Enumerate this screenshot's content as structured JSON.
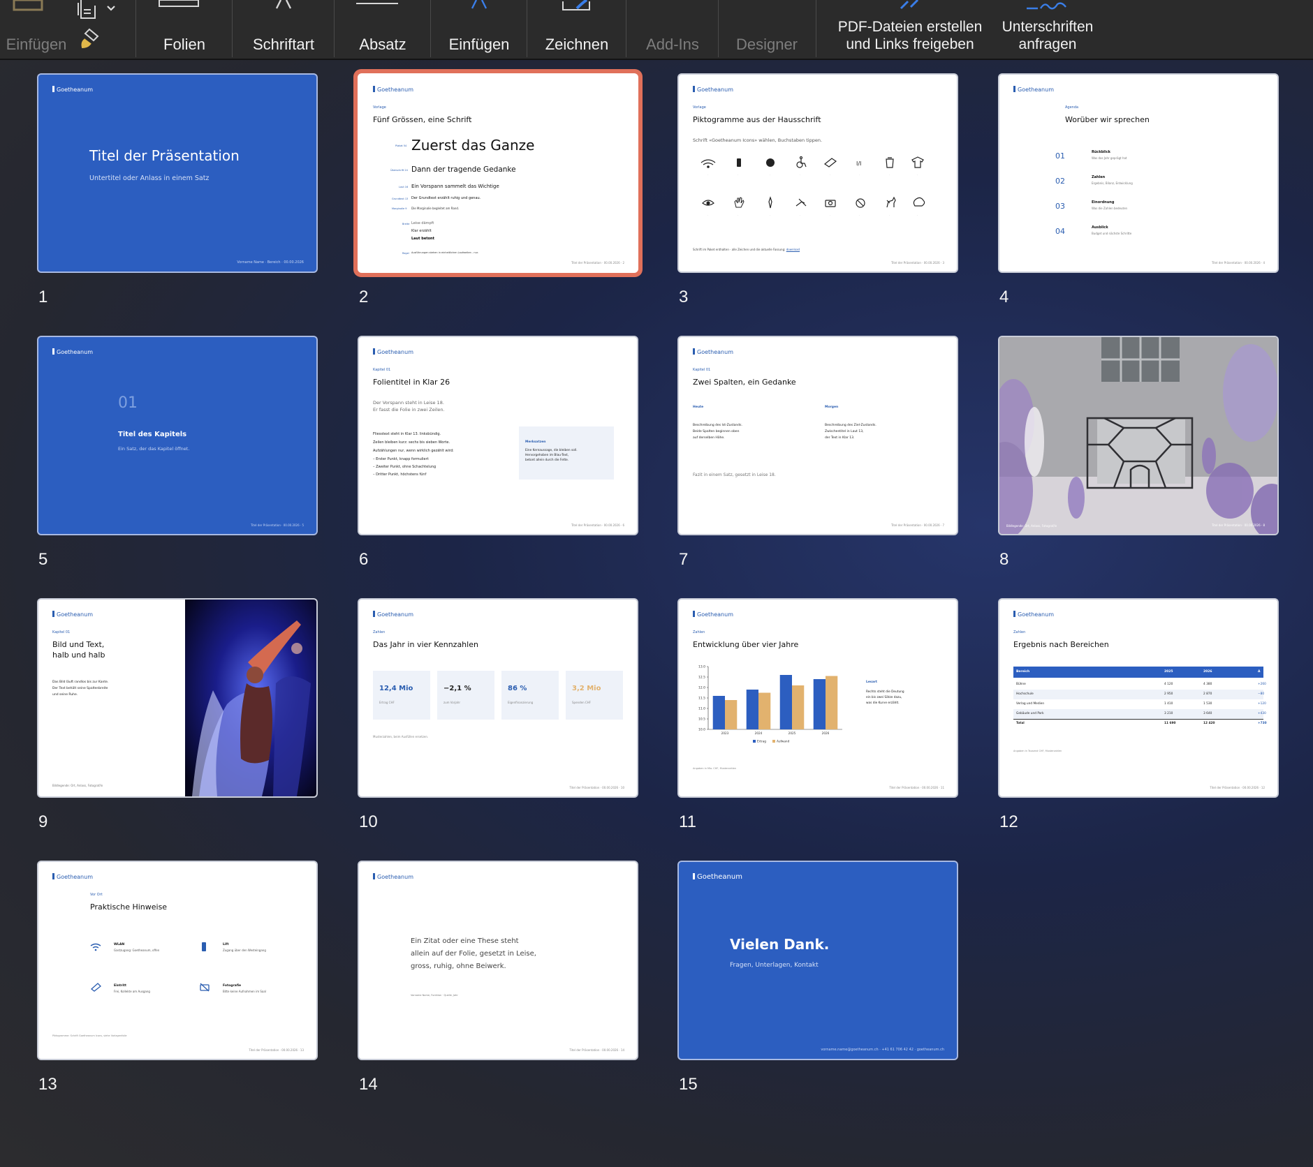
{
  "ribbon": {
    "einfuegen_left": "Einfügen",
    "folien": "Folien",
    "schriftart": "Schriftart",
    "absatz": "Absatz",
    "einfuegen": "Einfügen",
    "zeichnen": "Zeichnen",
    "addins": "Add-Ins",
    "designer": "Designer",
    "pdf_line1": "PDF-Dateien erstellen",
    "pdf_line2": "und Links freigeben",
    "sign_line1": "Unterschriften",
    "sign_line2": "anfragen"
  },
  "colors": {
    "accent_blue": "#2c5ec0",
    "selection": "#e0705a",
    "gold": "#e2b26e"
  },
  "slides": {
    "s1": {
      "num": "1",
      "logo": "Goetheanum",
      "title": "Titel der Präsentation",
      "subtitle": "Untertitel oder Anlass in einem Satz",
      "footer": "Vorname Name · Bereich · 00.00.2026"
    },
    "s2": {
      "num": "2",
      "logo": "Goetheanum",
      "kicker": "Vorlage",
      "title": "Fünf Grössen, eine Schrift",
      "rows": [
        {
          "label": "Plakat 54",
          "text": "Zuerst das Ganze"
        },
        {
          "label": "Überschrift 24",
          "text": "Dann der tragende Gedanke"
        },
        {
          "label": "Laut 16",
          "text": "Ein Vorspann sammelt das Wichtige"
        },
        {
          "label": "Grundtext 13",
          "text": "Der Grundtext erzählt ruhig und genau."
        },
        {
          "label": "Marginalie 9",
          "text": "Die Marginalie begleitet am Rand."
        }
      ],
      "weights_label": "Breite",
      "weights": [
        "Leise dämpft",
        "Klar erzählt",
        "Laut betont"
      ],
      "rule_label": "Regel",
      "rule": "Ausführungen stehen in einheitlichen Laufweiten - nur.",
      "footer": "Titel der Präsentation · 00.00.2026 · 2"
    },
    "s3": {
      "num": "3",
      "logo": "Goetheanum",
      "kicker": "Vorlage",
      "title": "Piktogramme aus der Hausschrift",
      "intro": "Schrift «Goetheanum Icons» wählen, Buchstaben tippen.",
      "icons_row1": [
        "wifi-icon",
        "phone-icon",
        "clock-icon",
        "wheelchair-icon",
        "ticket-icon",
        "wc-icon",
        "trash-icon",
        "shirt-icon"
      ],
      "icons_row2": [
        "eye-icon",
        "hand-icon",
        "microphone-icon",
        "no-smoking-icon",
        "camera-icon",
        "no-photo-icon",
        "dog-icon",
        "brain-icon"
      ],
      "row1_chars": [
        "a",
        "b",
        "c",
        "d",
        "e",
        "f",
        "g",
        "h"
      ],
      "row2_chars": [
        "i",
        "j",
        "k",
        "l",
        "m",
        "n",
        "o",
        "p"
      ],
      "note": "Schrift im Paket enthalten · alle Zeichen und die aktuelle Fassung:",
      "note_link": "download",
      "footer": "Titel der Präsentation · 00.00.2026 · 3"
    },
    "s4": {
      "num": "4",
      "logo": "Goetheanum",
      "kicker": "Agenda",
      "title": "Worüber wir sprechen",
      "items": [
        {
          "n": "01",
          "title": "Rückblick",
          "sub": "Was das Jahr geprägt hat"
        },
        {
          "n": "02",
          "title": "Zahlen",
          "sub": "Ergebnis, Bilanz, Entwicklung"
        },
        {
          "n": "03",
          "title": "Einordnung",
          "sub": "Was die Zahlen bedeuten"
        },
        {
          "n": "04",
          "title": "Ausblick",
          "sub": "Budget und nächste Schritte"
        }
      ],
      "footer": "Titel der Präsentation · 00.00.2026 · 4"
    },
    "s5": {
      "num": "5",
      "logo": "Goetheanum",
      "chapter": "01",
      "title": "Titel des Kapitels",
      "sub": "Ein Satz, der das Kapitel öffnet.",
      "footer": "Titel der Präsentation · 00.00.2026 · 5"
    },
    "s6": {
      "num": "6",
      "logo": "Goetheanum",
      "kicker": "Kapitel 01",
      "title": "Folientitel in Klar 26",
      "lead1": "Der Vorspann steht in Leise 18.",
      "lead2": "Er fasst die Folie in zwei Zeilen.",
      "body": [
        "Fliesstext steht in Klar 13. linksbündig.",
        "Zeilen bleiben kurz: sechs bis sieben Worte.",
        "Aufzählungen nur, wenn wirklich gezählt wird:",
        "– Erster Punkt, knapp formuliert",
        "– Zweiter Punkt, ohne Schachtelung",
        "– Dritter Punkt, höchstens fünf"
      ],
      "box_title": "Merksatzen",
      "box": [
        "Eine Kernaussage, die bleiben soll.",
        "Hervorgehoben im Blau-Text,",
        "betont allein durch die Fette."
      ],
      "footer": "Titel der Präsentation · 00.00.2026 · 6"
    },
    "s7": {
      "num": "7",
      "logo": "Goetheanum",
      "kicker": "Kapitel 01",
      "title": "Zwei Spalten, ein Gedanke",
      "col1_title": "Heute",
      "col1": [
        "Beschreibung des Ist-Zustands.",
        "Beide Spalten beginnen oben",
        "auf derselben Höhe."
      ],
      "col2_title": "Morgen",
      "col2": [
        "Beschreibung des Ziel-Zustands.",
        "Zwischentitel in Laut 13,",
        "der Text in Klar 13."
      ],
      "fazit": "Fazit in einem Satz, gesetzt in Leise 18.",
      "footer": "Titel der Präsentation · 00.00.2026 · 7"
    },
    "s8": {
      "num": "8",
      "caption": "Bildlegende: Ort, Anlass, Fotograf/in",
      "footer": "Titel der Präsentation · 00.00.2026 · 8"
    },
    "s9": {
      "num": "9",
      "logo": "Goetheanum",
      "kicker": "Kapitel 01",
      "title1": "Bild und Text,",
      "title2": "halb und halb",
      "body": [
        "Das Bild läuft randlos bis zur Kante.",
        "Der Text behält seine Spaltenbreite",
        "und seine Ruhe."
      ],
      "caption": "Bildlegende: Ort, Anlass, Fotograf/in"
    },
    "s10": {
      "num": "10",
      "logo": "Goetheanum",
      "kicker": "Zahlen",
      "title": "Das Jahr in vier Kennzahlen",
      "kpis": [
        {
          "value": "12,4 Mio",
          "label": "Ertrag CHF",
          "color": "#2a5db0"
        },
        {
          "value": "−2,1 %",
          "label": "zum Vorjahr",
          "color": "#222222"
        },
        {
          "value": "86 %",
          "label": "Eigenfinanzierung",
          "color": "#2a5db0"
        },
        {
          "value": "3,2 Mio",
          "label": "Spenden CHF",
          "color": "#e2b26e"
        }
      ],
      "note": "Musterzahlen, beim Ausfüllen ersetzen.",
      "footer": "Titel der Präsentation · 00.00.2026 · 10"
    },
    "s11": {
      "num": "11",
      "logo": "Goetheanum",
      "kicker": "Zahlen",
      "title": "Entwicklung über vier Jahre",
      "side_title": "Lesart",
      "side": [
        "Rechts steht die Deutung",
        "ein bis zwei Sätze dazu,",
        "was die Kurve erzählt."
      ],
      "source": "Angaben in Mio. CHF, Musterzahlen",
      "footer": "Titel der Präsentation · 00.00.2026 · 11"
    },
    "s12": {
      "num": "12",
      "logo": "Goetheanum",
      "kicker": "Zahlen",
      "title": "Ergebnis nach Bereichen",
      "headers": [
        "Bereich",
        "2025",
        "2026",
        "Δ"
      ],
      "rows": [
        [
          "Bühne",
          "4 120",
          "4 380",
          "+260"
        ],
        [
          "Hochschule",
          "2 950",
          "2 870",
          "−80"
        ],
        [
          "Verlag und Medien",
          "1 410",
          "1 530",
          "+120"
        ],
        [
          "Gebäude und Park",
          "3 210",
          "3 640",
          "+430"
        ],
        [
          "Total",
          "11 690",
          "12 420",
          "+730"
        ]
      ],
      "note": "Angaben in Tausend CHF, Musterzahlen",
      "footer": "Titel der Präsentation · 00.00.2026 · 12"
    },
    "s13": {
      "num": "13",
      "logo": "Goetheanum",
      "kicker": "Vor Ort",
      "title": "Praktische Hinweise",
      "items": [
        {
          "icon": "wifi-icon",
          "title": "WLAN",
          "sub": "Gastzugang: Goetheanum, offen"
        },
        {
          "icon": "phone-icon",
          "title": "Lift",
          "sub": "Zugang über den Westeingang"
        },
        {
          "icon": "ticket-icon",
          "title": "Eintritt",
          "sub": "Frei, Kollekte am Ausgang"
        },
        {
          "icon": "no-photo-icon",
          "title": "Fotografie",
          "sub": "Bitte keine Aufnahmen im Saal"
        }
      ],
      "note": "Piktogramme: Schrift Goetheanum Icons, siehe Vorlagenfolie",
      "footer": "Titel der Präsentation · 00.00.2026 · 13"
    },
    "s14": {
      "num": "14",
      "logo": "Goetheanum",
      "quote": [
        "Ein Zitat oder eine These steht",
        "allein auf der Folie, gesetzt in Leise,",
        "gross, ruhig, ohne Beiwerk."
      ],
      "source": "Vorname Name, Funktion · Quelle, Jahr",
      "footer": "Titel der Präsentation · 00.00.2026 · 14"
    },
    "s15": {
      "num": "15",
      "logo": "Goetheanum",
      "title": "Vielen Dank.",
      "sub": "Fragen, Unterlagen, Kontakt",
      "footer": "vorname.name@goetheanum.ch · +41 61 706 42 42 · goetheanum.ch"
    }
  },
  "chart_data": {
    "type": "bar",
    "categories": [
      "2023",
      "2024",
      "2025",
      "2026"
    ],
    "series": [
      {
        "name": "Ertrag",
        "values": [
          11.6,
          11.9,
          12.6,
          12.4
        ],
        "color": "#2c5ec0"
      },
      {
        "name": "Aufwand",
        "values": [
          11.4,
          11.75,
          12.1,
          12.55
        ],
        "color": "#e2b26e"
      }
    ],
    "yticks": [
      "13.0",
      "12.5",
      "12.0",
      "11.5",
      "11.0",
      "10.5",
      "10.0"
    ],
    "ylim": [
      10.0,
      13.0
    ],
    "legend": "bottom",
    "grid": false
  }
}
